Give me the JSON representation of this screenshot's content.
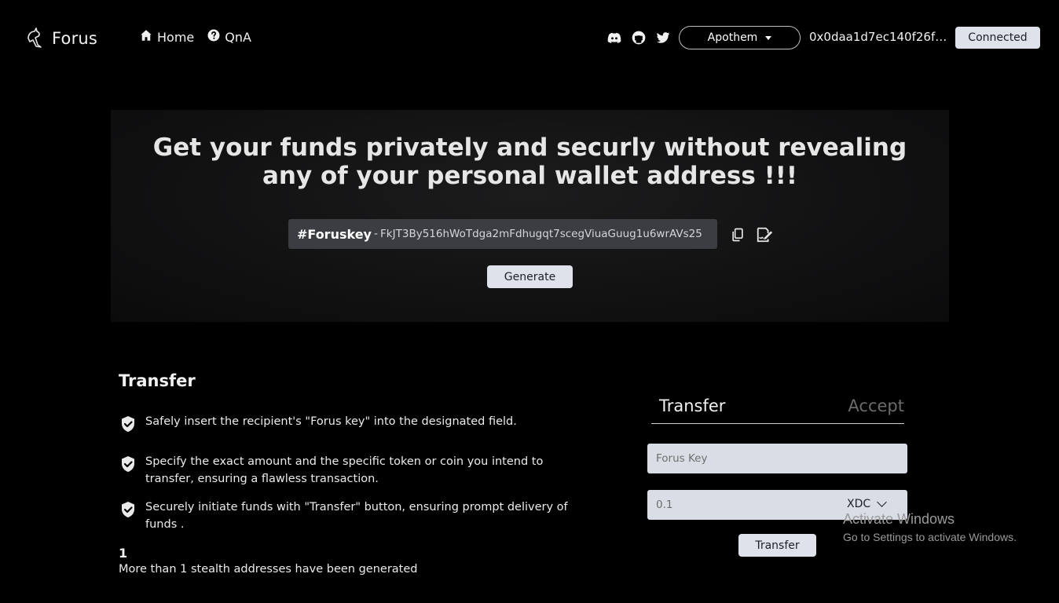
{
  "header": {
    "brand": "Forus",
    "nav": [
      {
        "label": "Home",
        "icon": "home-icon"
      },
      {
        "label": "QnA",
        "icon": "question-circle-icon"
      }
    ],
    "social": [
      "discord-icon",
      "github-icon",
      "twitter-icon"
    ],
    "network": "Apothem",
    "wallet_address": "0x0daa1d7ec140f26fb...",
    "connection_status": "Connected"
  },
  "hero": {
    "title": "Get your funds privately and securly without revealing any of your personal wallet address !!!",
    "key_label": "#Foruskey",
    "key_separator": "-",
    "key_value": "FkJT3By516hWoTdga2mFdhugqt7scegViuaGuug1u6wrAVs25",
    "generate_label": "Generate"
  },
  "transfer_info": {
    "title": "Transfer",
    "steps": [
      "Safely insert the recipient's \"Forus key\" into the designated field.",
      "Specify the exact amount and the specific token or coin you intend to transfer, ensuring a flawless transaction.",
      "Securely initiate funds with \"Transfer\" button, ensuring prompt delivery of funds ."
    ],
    "count": "1",
    "count_text": "More than 1 stealth addresses have been generated"
  },
  "form": {
    "tabs": [
      "Transfer",
      "Accept"
    ],
    "active_tab": "Transfer",
    "key_placeholder": "Forus Key",
    "amount_value": "0.1",
    "token": "XDC",
    "submit_label": "Transfer"
  },
  "watermark": {
    "title": "Activate Windows",
    "subtitle": "Go to Settings to activate Windows."
  },
  "colors": {
    "background": "#000000",
    "button_bg": "#dfe2ea",
    "key_box_bg": "#3b3d42",
    "field_bg": "#d9dde5"
  }
}
